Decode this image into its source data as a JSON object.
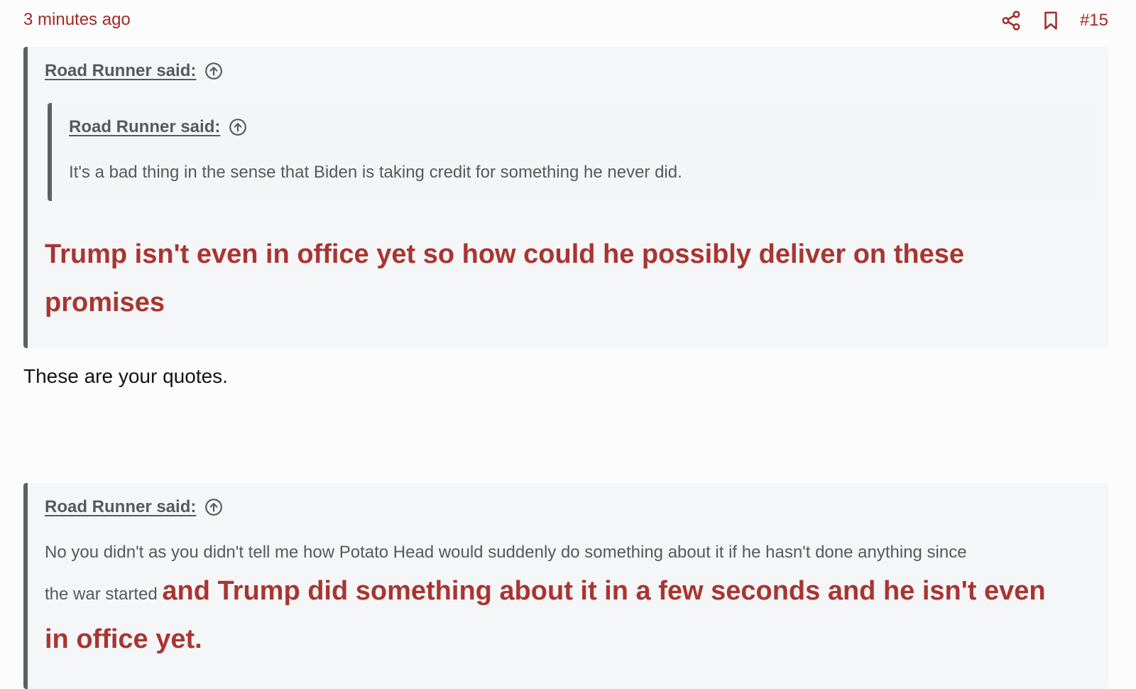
{
  "header": {
    "timestamp": "3 minutes ago",
    "post_number": "#15",
    "icons": [
      "share-icon",
      "bookmark-icon"
    ]
  },
  "quote1": {
    "author_label": "Road Runner said:",
    "nested_quote": {
      "author_label": "Road Runner said:",
      "text": "It's a bad thing in the sense that Biden is taking credit for something he never did."
    },
    "emphasis_line1": "Trump isn't even in office yet so how could he possibly deliver on these",
    "emphasis_line2": "promises"
  },
  "reply": {
    "text": "These are your quotes."
  },
  "quote2": {
    "author_label": "Road Runner said:",
    "text_line1": "No you didn't as you didn't tell me how Potato Head would suddenly do something about it if he hasn't done anything since",
    "text_line2_plain": "the war started",
    "text_line2_emphasis": "and Trump did something about it in a few seconds and he isn't even",
    "emphasis_line3": "in office yet."
  },
  "colors": {
    "accent_red": "#a32a25",
    "emphasis_red": "#a93530",
    "quote_border": "#5c5f63",
    "quote_bg": "#f5f6f8"
  }
}
